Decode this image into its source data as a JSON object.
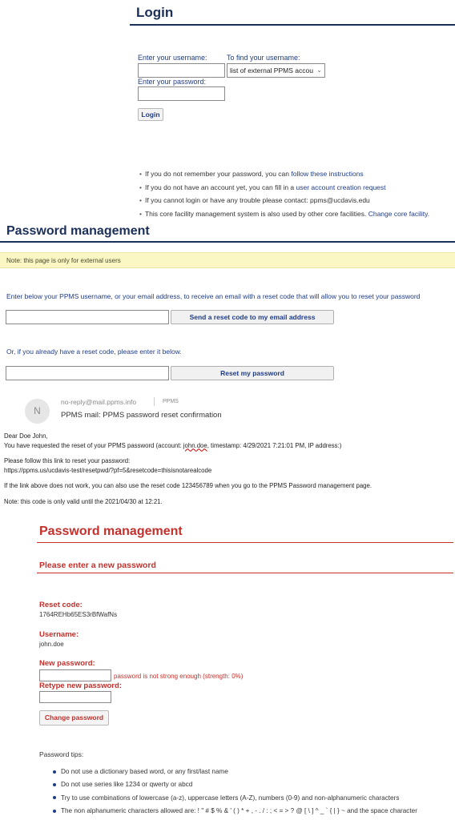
{
  "login": {
    "title": "Login",
    "username_label": "Enter your username:",
    "find_username_label": "To find your username:",
    "find_username_select": "list of external PPMS accou",
    "password_label": "Enter your password:",
    "login_button": "Login",
    "info": [
      {
        "text": "If you do not remember your password, you can ",
        "link": "follow these instructions"
      },
      {
        "text": "If you do not have an account yet, you can fill in a ",
        "link": "user account creation request"
      },
      {
        "text": "If you cannot login or have any trouble please contact: ppms@ucdavis.edu",
        "link": ""
      },
      {
        "text": "This core facility management system is also used by other core facilities. ",
        "link": "Change core facility."
      }
    ]
  },
  "password_management": {
    "title": "Password management",
    "note": "Note: this page is only for external users",
    "instruction": "Enter below your PPMS username, or your email address, to receive an email with a reset code that will allow you to reset your password",
    "send_button": "Send a reset code to my email address",
    "reset_code_prompt": "Or, if you already have a reset code, please enter it below.",
    "reset_button": "Reset my password"
  },
  "email": {
    "avatar_initial": "N",
    "sender": "no-reply@mail.ppms.info",
    "tag": "PPMS",
    "subject": "PPMS mail: PPMS password reset confirmation",
    "greeting": "Dear Doe John,",
    "line1_pre": "You have requested the reset of your PPMS password (account: ",
    "line1_account": "john.doe",
    "line1_post": ", timestamp: 4/29/2021 7:21:01 PM, IP address:)",
    "line2": "Please follow this link to reset your password:",
    "link": "https://ppms.us/ucdavis-test/resetpwd/?pf=5&resetcode=thisisnotarealcode",
    "line3": "If the link above does not work, you can also use the reset code 123456789 when you go to the PPMS Password management page.",
    "line4": "Note: this code is only valid until the 2021/04/30 at 12:21."
  },
  "reset": {
    "title": "Password management",
    "subtitle": "Please enter a new password",
    "reset_code_label": "Reset code:",
    "reset_code_value": "1764REHb65ES3rBfWafNs",
    "username_label": "Username:",
    "username_value": "john.doe",
    "new_password_label": "New password:",
    "strength_message": "password is not strong enough (strength: 0%)",
    "retype_label": "Retype new password:",
    "change_button": "Change password",
    "tips_heading": "Password tips:",
    "tips": [
      "Do not use a dictionary based word, or any first/last name",
      "Do not use series like 1234 or qwerty or abcd",
      "Try to use combinations of lowercase (a-z), uppercase letters (A-Z), numbers (0-9) and non-alphanumeric characters",
      "The non alphanumeric characters allowed are: ! \" # $ % & ' ( ) * + , - . / : ; < = > ? @ [ \\ ] ^ _ ` { | } ~ and the space character"
    ]
  },
  "colors": {
    "navy": "#1a2f5a",
    "link_blue": "#1f3c88",
    "red": "#c4302b",
    "note_yellow": "#fbf7c5"
  }
}
